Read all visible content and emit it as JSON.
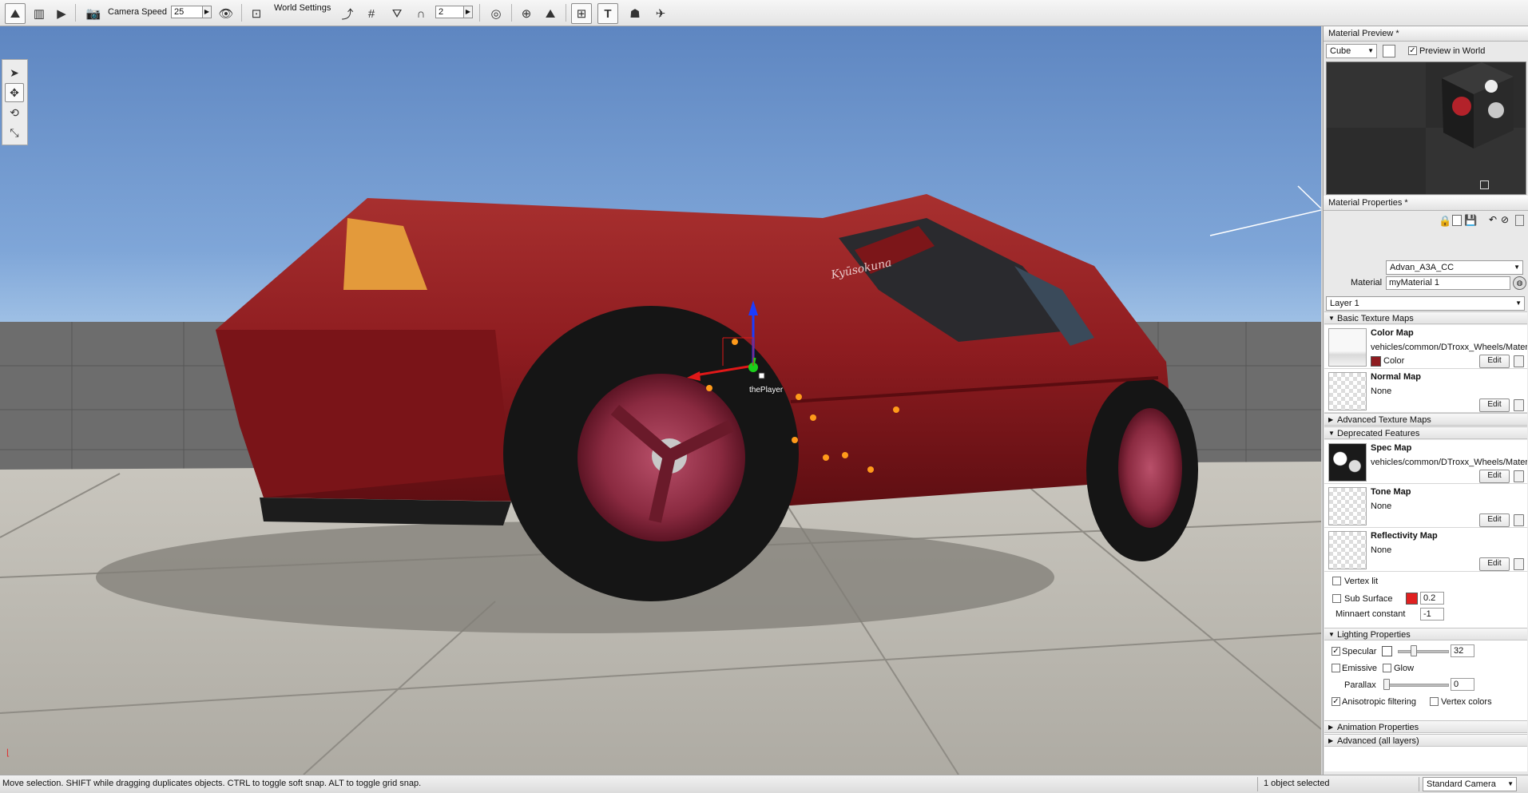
{
  "toolbar": {
    "camera_speed_label": "Camera Speed",
    "camera_speed_value": "25",
    "world_settings_label": "World Settings",
    "grid_value": "2"
  },
  "viewport": {
    "selected_object_label": "thePlayer",
    "car_badge_text": "Kyūsokuna",
    "colors": {
      "car_body": "#8e1c20",
      "sky_top": "#5e86c1",
      "floor": "#bebbb2"
    }
  },
  "material_preview": {
    "title": "Material Preview *",
    "shape": "Cube",
    "preview_in_world_label": "Preview in World",
    "preview_in_world": true
  },
  "material_properties": {
    "title": "Material Properties *",
    "material_name": "Advan_A3A_CC",
    "material_label": "Material",
    "material_value": "myMaterial 1",
    "layer": "Layer 1",
    "sections": {
      "basic": "Basic Texture Maps",
      "advanced": "Advanced Texture Maps",
      "deprecated": "Deprecated Features",
      "lighting": "Lighting Properties",
      "animation": "Animation Properties",
      "advanced_all": "Advanced (all layers)"
    },
    "color_map": {
      "title": "Color Map",
      "path": "vehicles/common/DTroxx_Wheels/Materials",
      "color_label": "Color",
      "color": "#8e1c20"
    },
    "normal_map": {
      "title": "Normal Map",
      "path": "None"
    },
    "spec_map": {
      "title": "Spec Map",
      "path": "vehicles/common/DTroxx_Wheels/Materials"
    },
    "tone_map": {
      "title": "Tone Map",
      "path": "None"
    },
    "reflectivity_map": {
      "title": "Reflectivity Map",
      "path": "None"
    },
    "edit_label": "Edit",
    "vertex_lit_label": "Vertex lit",
    "sub_surface_label": "Sub Surface",
    "sub_surface_color": "#e02020",
    "sub_surface_value": "0.2",
    "minnaert_label": "Minnaert constant",
    "minnaert_value": "-1",
    "specular_label": "Specular",
    "specular_value": "32",
    "emissive_label": "Emissive",
    "glow_label": "Glow",
    "parallax_label": "Parallax",
    "parallax_value": "0",
    "anisotropic_label": "Anisotropic filtering",
    "vertex_colors_label": "Vertex colors"
  },
  "status": {
    "message": "Move selection.  SHIFT while dragging duplicates objects.  CTRL to toggle soft snap.  ALT to toggle grid snap.",
    "selection": "1 object selected",
    "camera": "Standard Camera"
  }
}
